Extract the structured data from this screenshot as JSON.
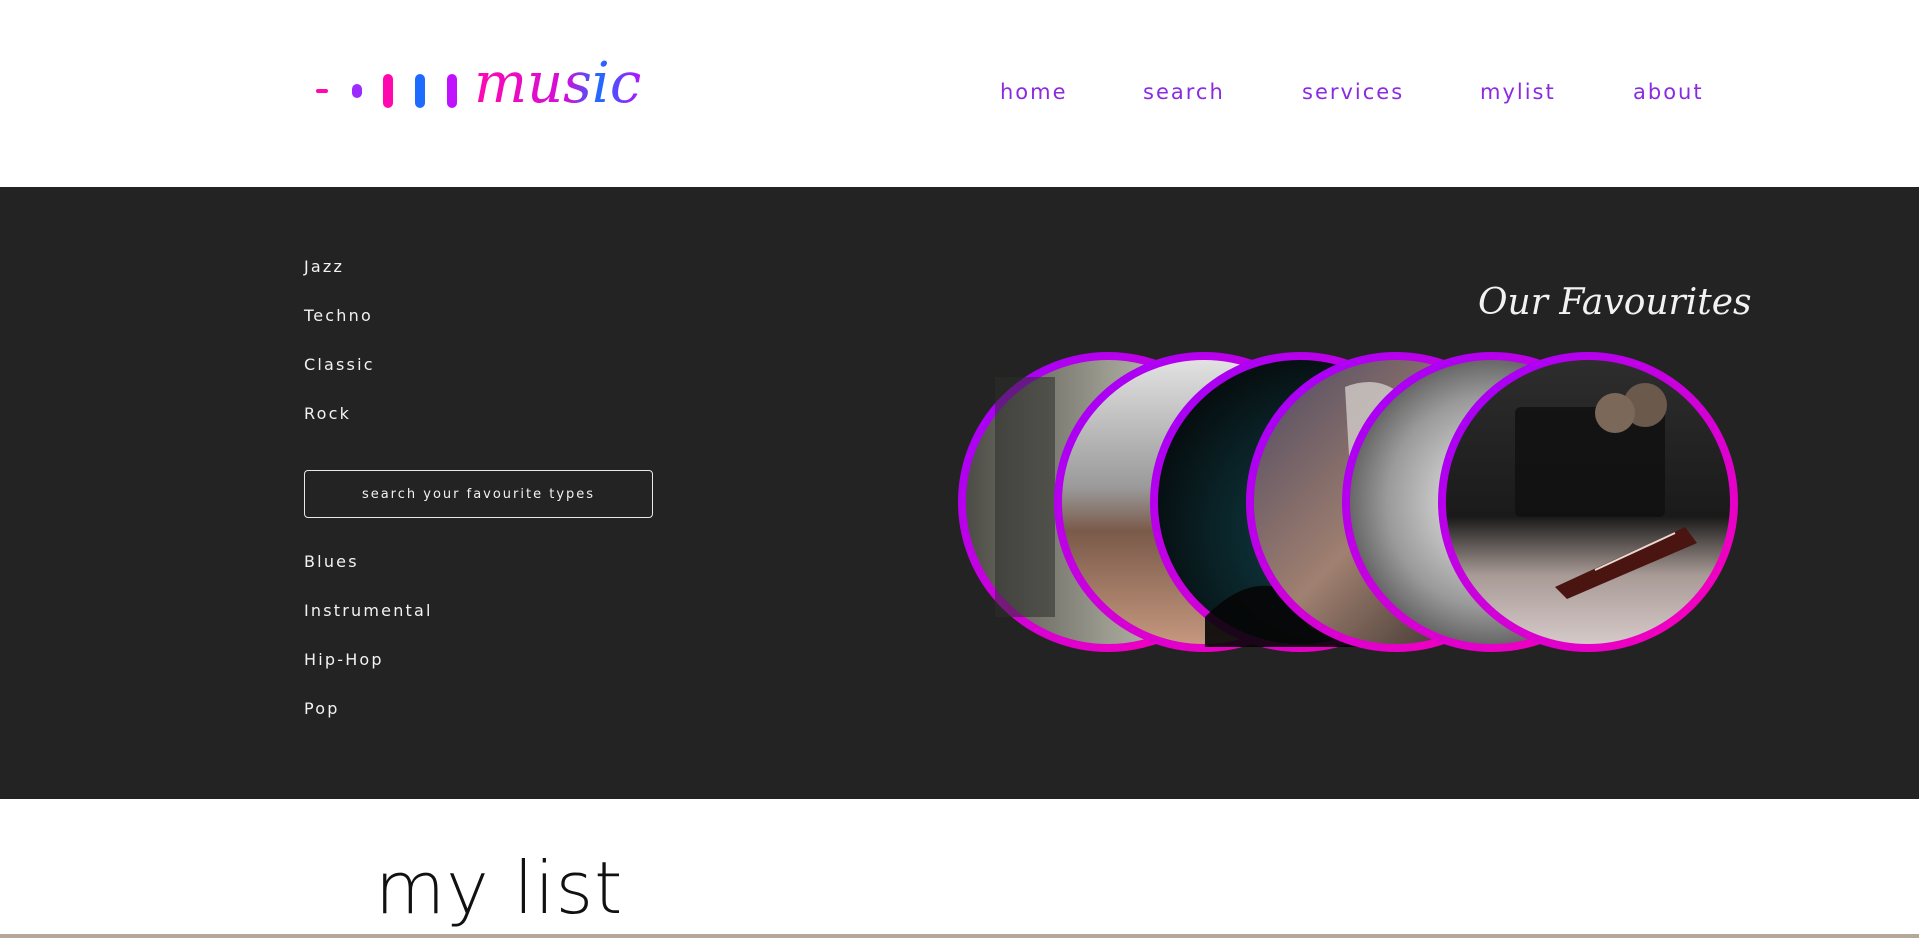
{
  "header": {
    "logo_text": "music",
    "nav": [
      "home",
      "search",
      "services",
      "mylist",
      "about"
    ]
  },
  "genres": {
    "items_top": [
      "Jazz",
      "Techno",
      "Classic",
      "Rock"
    ],
    "search_placeholder": "search your favourite types",
    "items_bottom": [
      "Blues",
      "Instrumental",
      "Hip-Hop",
      "Pop"
    ]
  },
  "favourites": {
    "title": "Our Favourites",
    "photos": [
      "street-photo",
      "vinyl-record-photo",
      "concert-crowd-photo",
      "woman-headphones-photo",
      "turntable-photo",
      "guitar-amp-photo"
    ]
  },
  "mylist": {
    "title": "my list"
  },
  "colors": {
    "nav": "#8a2be2",
    "pink": "#ff0aa8",
    "purple": "#a400ff",
    "blue": "#1e6bff",
    "band": "#232323"
  }
}
